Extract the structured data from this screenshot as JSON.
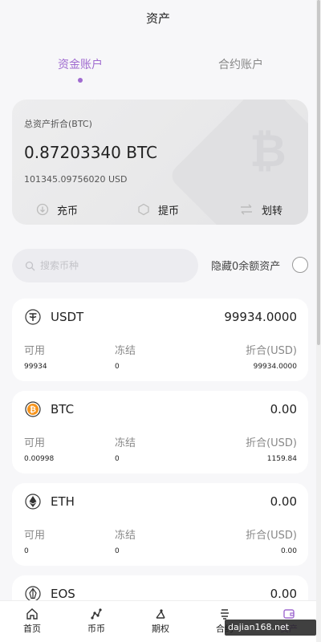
{
  "page": {
    "title": "资产"
  },
  "tabs": [
    {
      "label": "资金账户",
      "active": true
    },
    {
      "label": "合约账户",
      "active": false
    }
  ],
  "summary": {
    "label": "总资产折合(BTC)",
    "btc_value": "0.87203340 BTC",
    "usd_value": "101345.09756020 USD",
    "actions": {
      "deposit": "充币",
      "withdraw": "提币",
      "transfer": "划转"
    }
  },
  "search": {
    "placeholder": "搜索币种",
    "value": ""
  },
  "hide_zero": {
    "label": "隐藏0余额资产",
    "checked": false
  },
  "column_labels": {
    "available": "可用",
    "frozen": "冻结",
    "converted": "折合(USD)"
  },
  "coins": [
    {
      "name": "USDT",
      "total": "99934.0000",
      "available": "99934",
      "frozen": "0",
      "converted": "99934.0000",
      "icon": "tether-icon",
      "color": "#50af95"
    },
    {
      "name": "BTC",
      "total": "0.00",
      "available": "0.00998",
      "frozen": "0",
      "converted": "1159.84",
      "icon": "bitcoin-icon",
      "color": "#f7931a"
    },
    {
      "name": "ETH",
      "total": "0.00",
      "available": "0",
      "frozen": "0",
      "converted": "0.00",
      "icon": "ethereum-icon",
      "color": "#333333"
    },
    {
      "name": "EOS",
      "total": "0.00",
      "icon": "eos-icon",
      "color": "#333333"
    }
  ],
  "nav": [
    {
      "label": "首页",
      "icon": "home-icon"
    },
    {
      "label": "币币",
      "icon": "spot-icon"
    },
    {
      "label": "期权",
      "icon": "option-icon"
    },
    {
      "label": "合约",
      "icon": "contract-icon"
    },
    {
      "label": "资产",
      "icon": "wallet-icon",
      "active": true
    }
  ],
  "watermark": {
    "text": "dajian168.net"
  },
  "colors": {
    "accent": "#a06bd0",
    "card": "#ffffff",
    "background": "#f7f7f9"
  }
}
